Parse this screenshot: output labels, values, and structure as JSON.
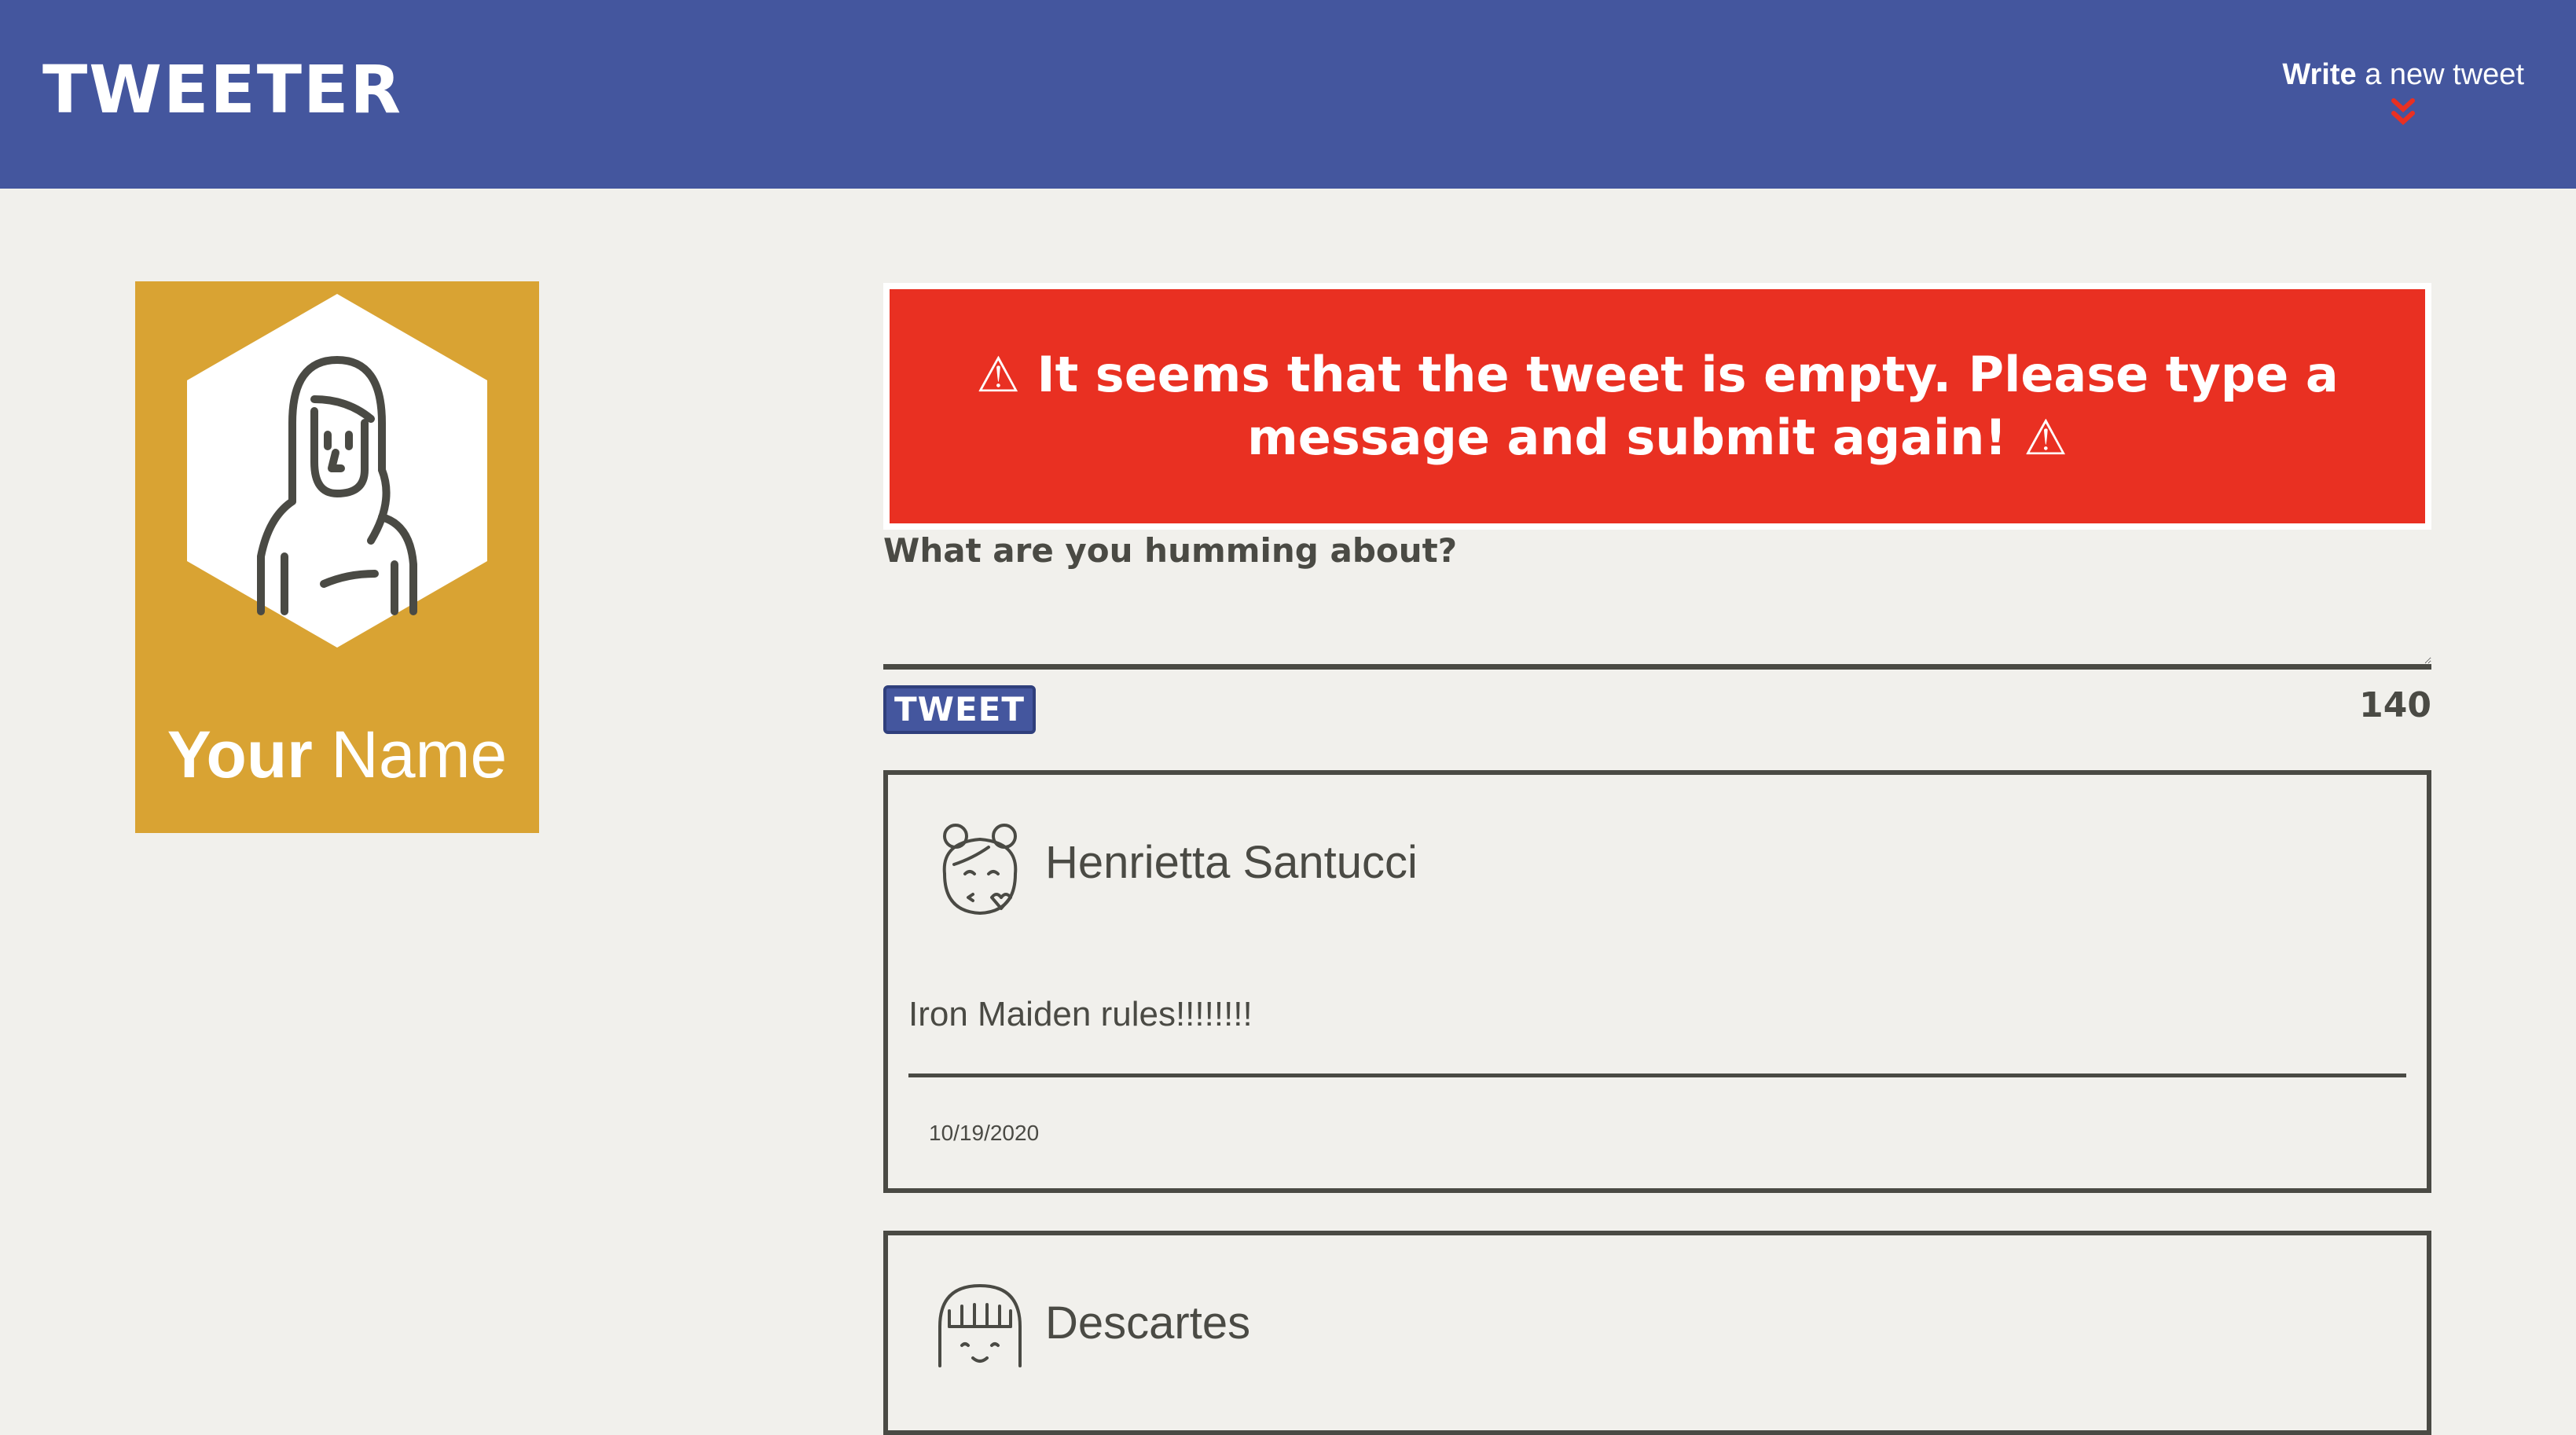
{
  "nav": {
    "brand": "TWEETER",
    "compose_bold": "Write",
    "compose_rest": " a new tweet",
    "compose_icon": "double-chevron-down-icon"
  },
  "profile": {
    "first": "Your",
    "last": " Name",
    "avatar_icon": "woman-avatar-icon",
    "bg_color": "#d9a333"
  },
  "composer": {
    "error_text": "⚠ It seems that the tweet is empty. Please type a message and submit again! ⚠",
    "prompt": "What are you humming about?",
    "value": "",
    "button": "TWEET",
    "counter": "140"
  },
  "tweets": [
    {
      "author": "Henrietta Santucci",
      "text": "Iron Maiden rules!!!!!!!!",
      "date": "10/19/2020",
      "avatar_icon": "girl-blowing-kiss-icon"
    },
    {
      "author": "Descartes",
      "avatar_icon": "bangs-avatar-icon"
    }
  ],
  "colors": {
    "nav": "#44569e",
    "error": "#e93022",
    "page": "#f1f0ec",
    "text": "#4a4a44"
  }
}
